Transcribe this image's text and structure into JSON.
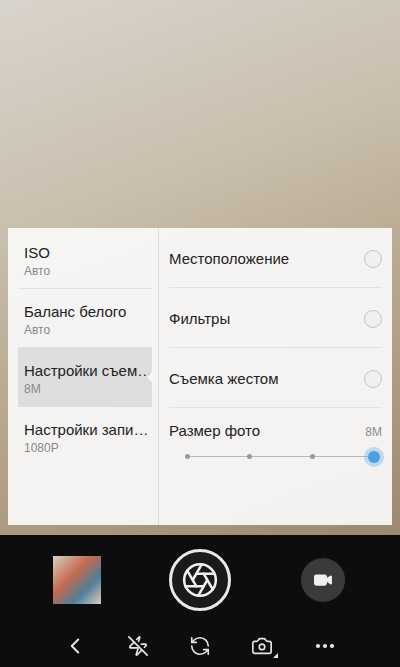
{
  "settings_menu": {
    "categories": [
      {
        "label": "ISO",
        "value": "Авто",
        "selected": false
      },
      {
        "label": "Баланс белого",
        "value": "Авто",
        "selected": false
      },
      {
        "label": "Настройки съем…",
        "value": "8M",
        "selected": true
      },
      {
        "label": "Настройки запи…",
        "value": "1080P",
        "selected": false
      }
    ],
    "options": [
      {
        "kind": "toggle",
        "label": "Местоположение",
        "on": false
      },
      {
        "kind": "toggle",
        "label": "Фильтры",
        "on": false
      },
      {
        "kind": "toggle",
        "label": "Съемка жестом",
        "on": false
      },
      {
        "kind": "slider",
        "label": "Размер фото",
        "reading": "8M",
        "level": 1,
        "steps": 4
      }
    ]
  },
  "toolbar": {
    "flash_on": false
  }
}
